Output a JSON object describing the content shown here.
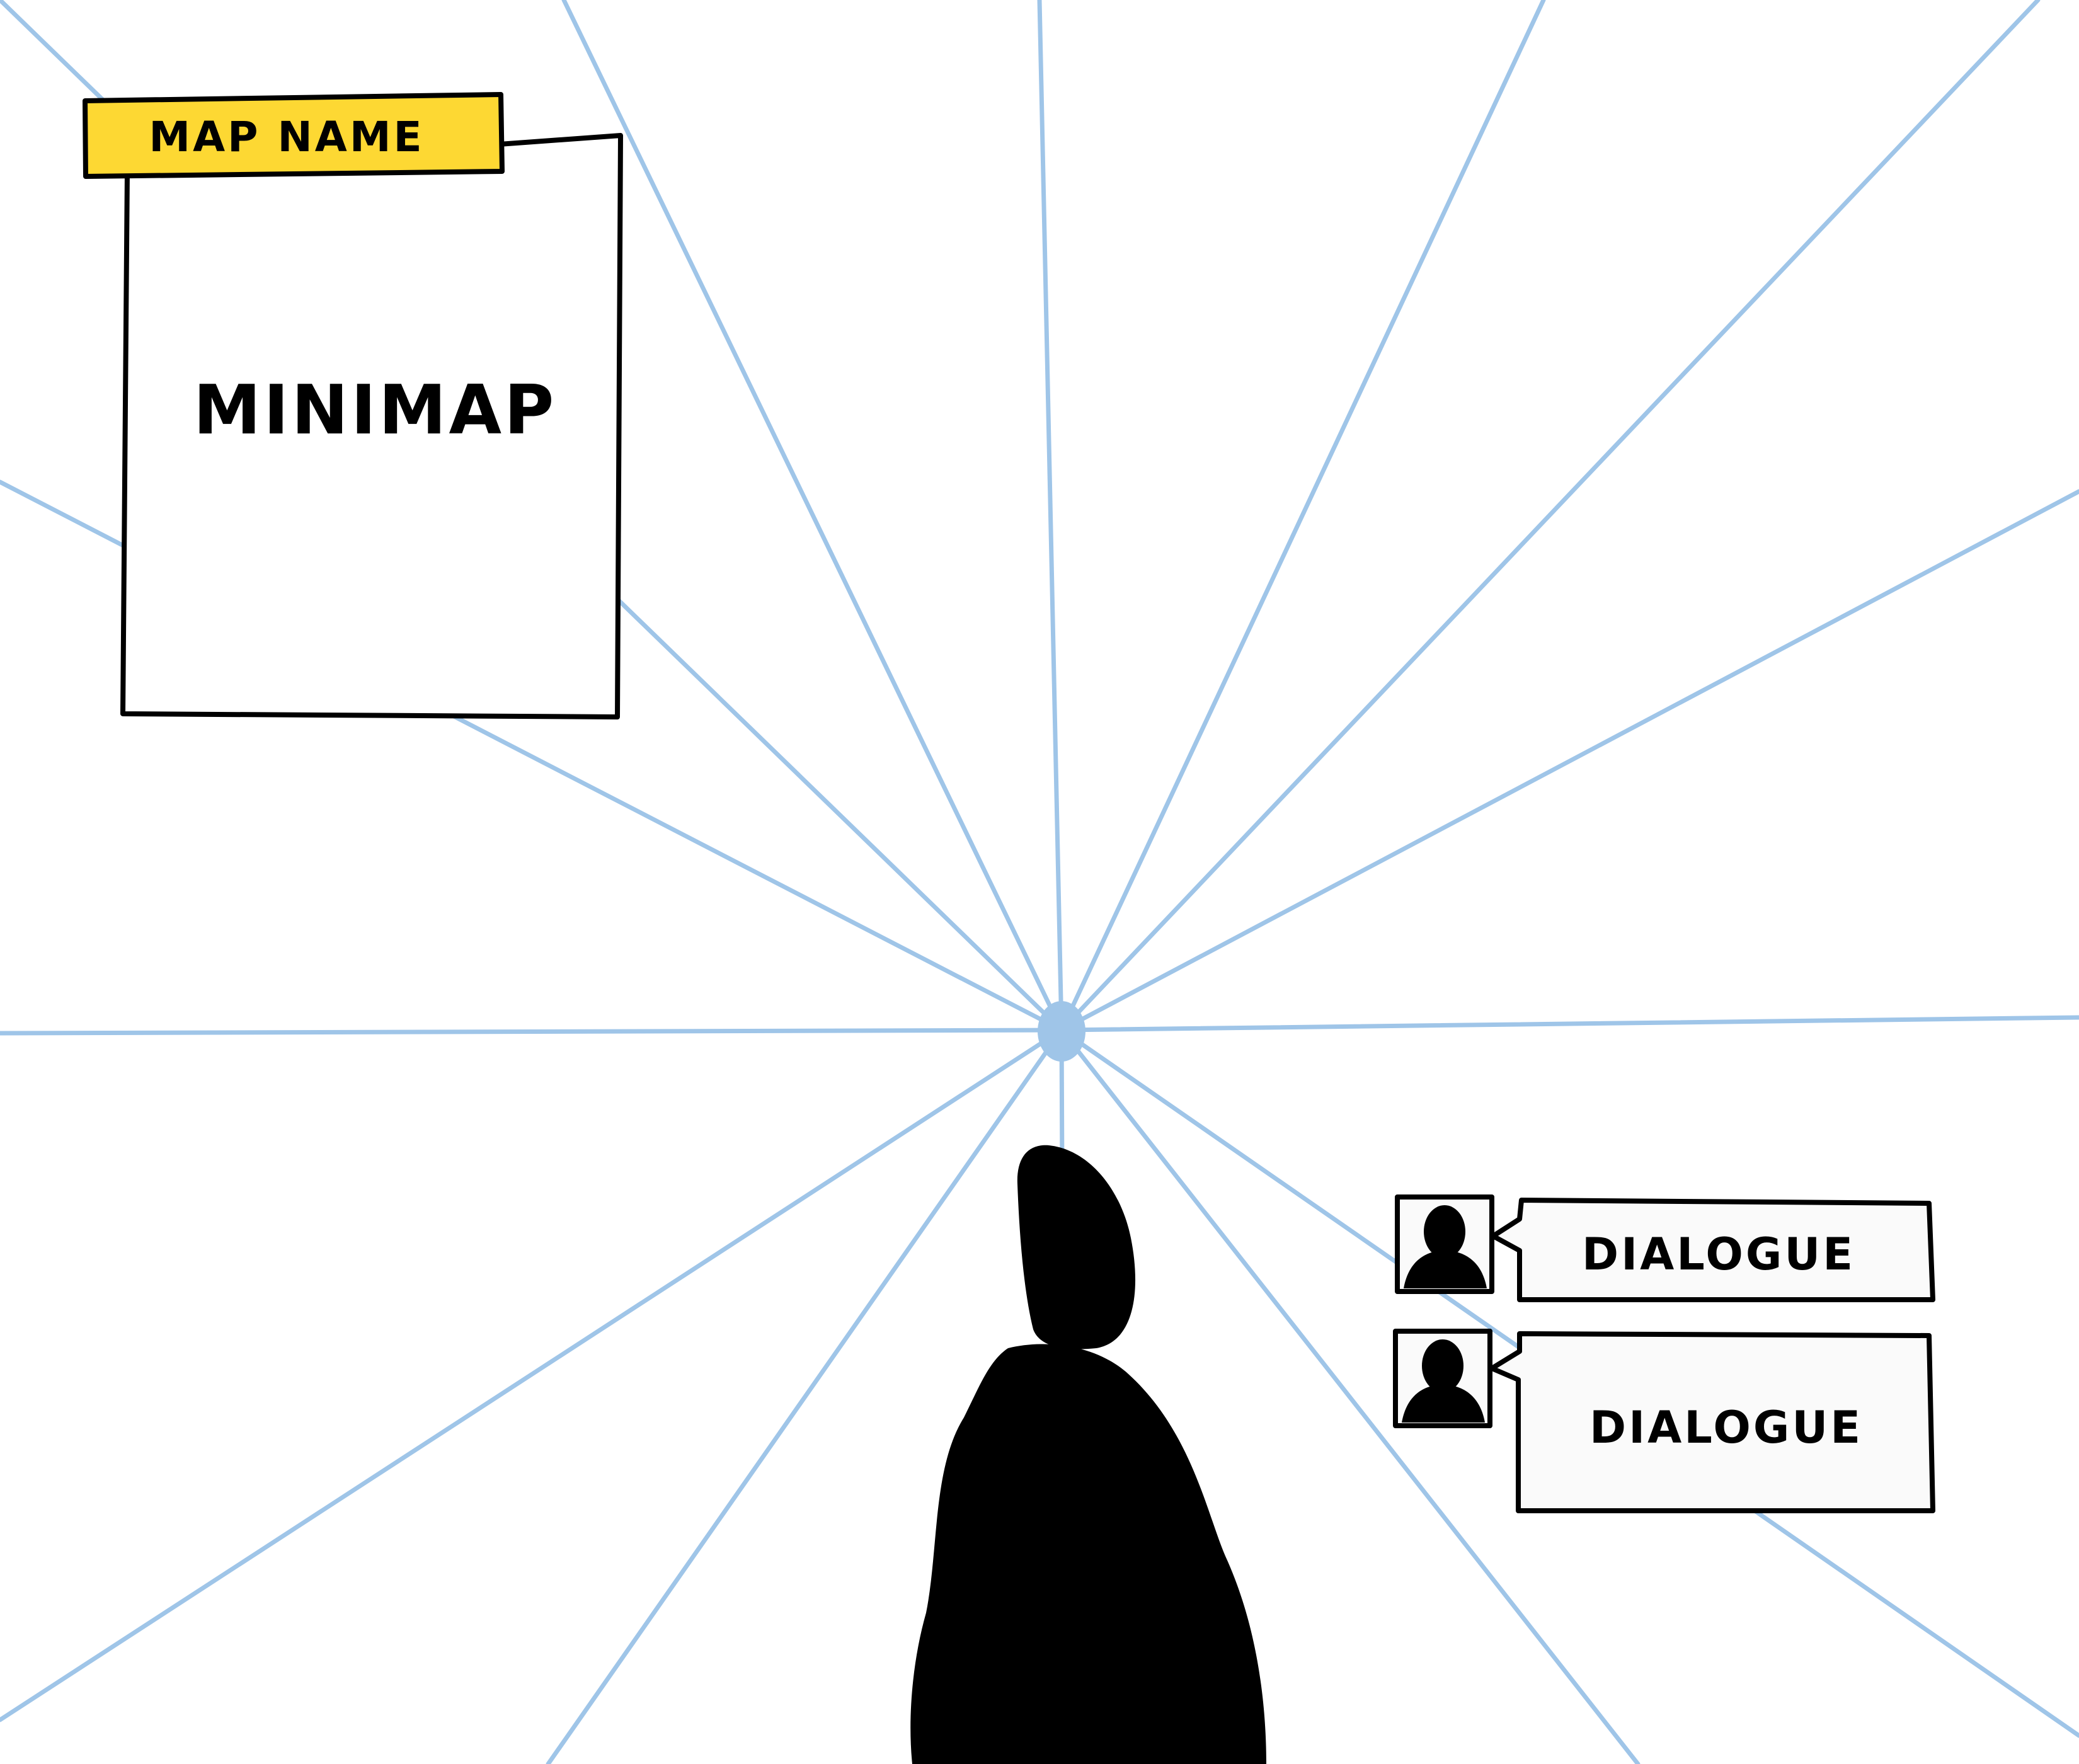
{
  "hud": {
    "map_name_label": "MAP NAME",
    "minimap_label": "MINIMAP",
    "map_name_color": "#fdd833"
  },
  "dialogues": [
    {
      "text": "DIALOGUE",
      "portrait_icon": "person-silhouette-icon"
    },
    {
      "text": "DIALOGUE",
      "portrait_icon": "person-silhouette-icon"
    }
  ],
  "player": {
    "icon": "player-silhouette"
  },
  "guides": {
    "color": "#9fc5e8",
    "vanishing_point_color": "#9fc5e8"
  }
}
